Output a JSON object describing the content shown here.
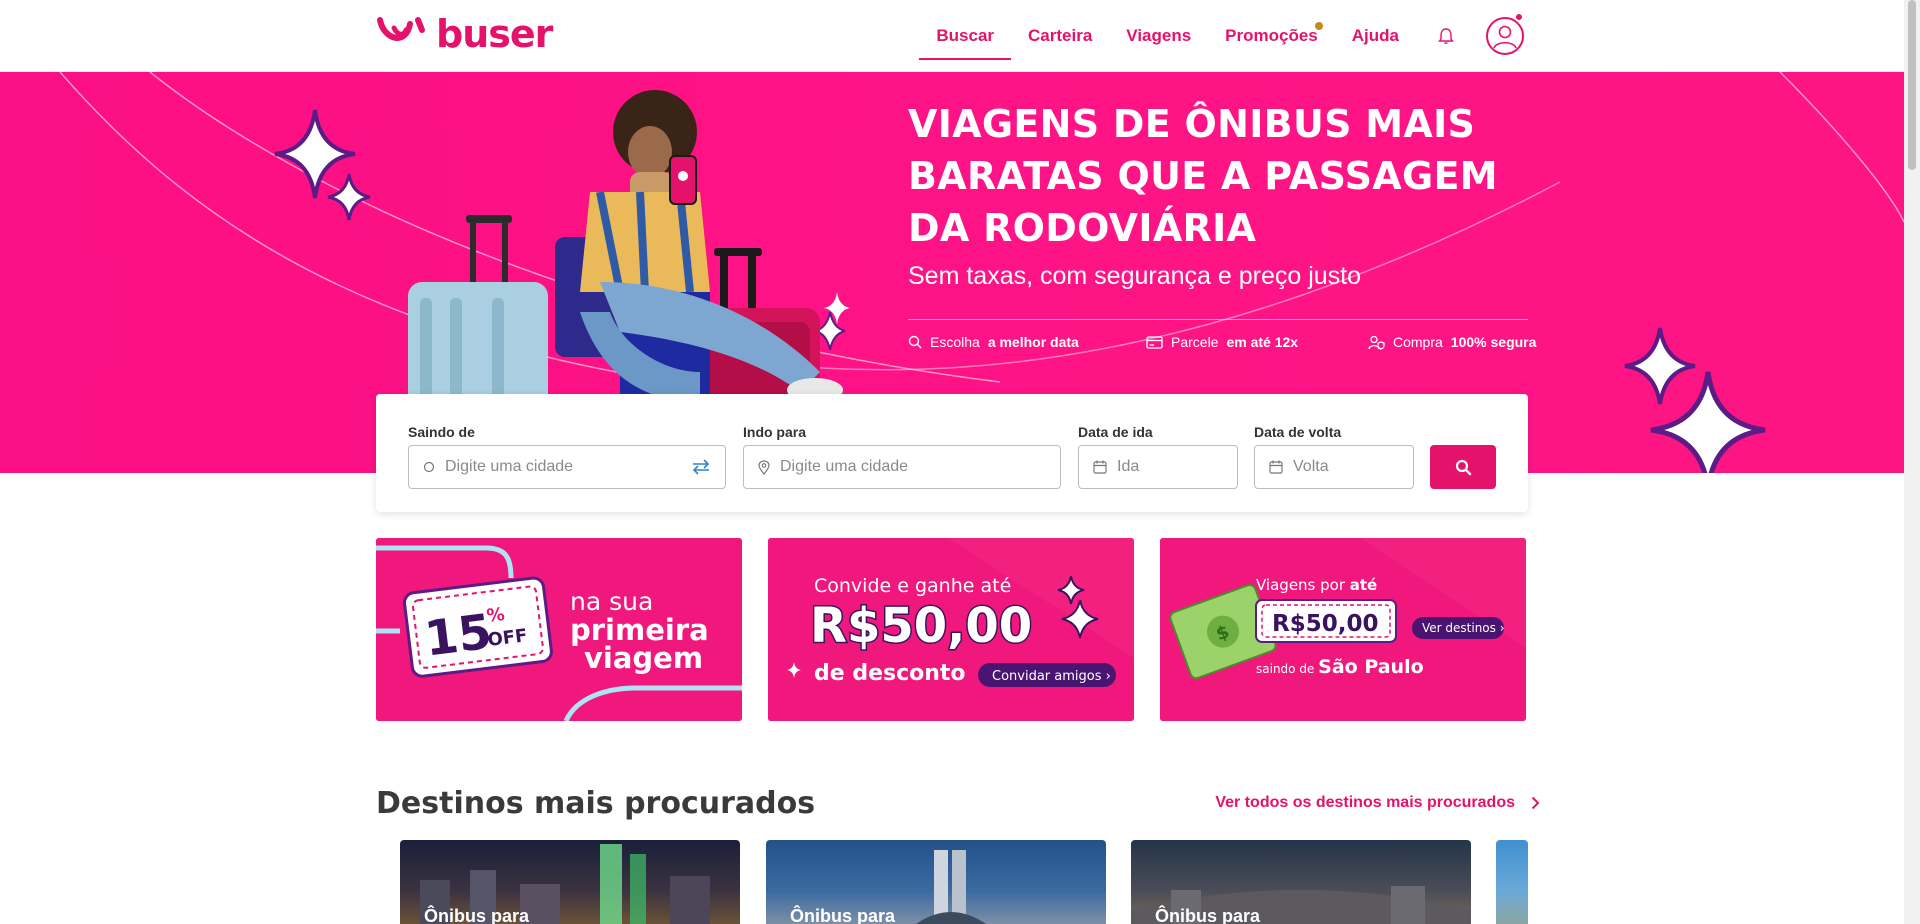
{
  "brand": {
    "name": "buser",
    "color": "#e5126b"
  },
  "nav": {
    "items": [
      {
        "label": "Buscar",
        "active": true
      },
      {
        "label": "Carteira"
      },
      {
        "label": "Viagens"
      },
      {
        "label": "Promoções"
      },
      {
        "label": "Ajuda"
      }
    ],
    "bell_icon": "bell-icon",
    "avatar_icon": "user-avatar-icon"
  },
  "hero": {
    "title": "VIAGENS DE ÔNIBUS MAIS BARATAS QUE A PASSAGEM DA RODOVIÁRIA",
    "subtitle": "Sem taxas, com segurança e preço justo",
    "features": [
      {
        "icon": "search-icon",
        "pre": "Escolha ",
        "bold": "a melhor data",
        "post": ""
      },
      {
        "icon": "card-icon",
        "pre": "Parcele ",
        "bold": "em até 12x",
        "post": ""
      },
      {
        "icon": "shield-user-icon",
        "pre": "Compra ",
        "bold": "100% segura",
        "post": ""
      }
    ]
  },
  "search": {
    "from_label": "Saindo de",
    "from_placeholder": "Digite uma cidade",
    "to_label": "Indo para",
    "to_placeholder": "Digite uma cidade",
    "depart_label": "Data de ida",
    "depart_placeholder": "Ida",
    "return_label": "Data de volta",
    "return_placeholder": "Volta"
  },
  "banners": {
    "b1": {
      "badge_number": "15",
      "badge_percent": "%",
      "badge_off": "OFF",
      "line1": "na sua",
      "line2": "primeira",
      "line3": "viagem"
    },
    "b2": {
      "line1": "Convide e ganhe até",
      "amount": "R$50,00",
      "line3": "de desconto",
      "button": "Convidar amigos ›"
    },
    "b3": {
      "line1_pre": "Viagens por ",
      "line1_bold": "até",
      "amount": "R$50,00",
      "button": "Ver destinos ›",
      "line3_pre": "saindo de ",
      "line3_bold": "São Paulo"
    }
  },
  "destinos": {
    "title": "Destinos mais procurados",
    "link": "Ver todos os destinos mais procurados",
    "cards": [
      {
        "label": "Ônibus para"
      },
      {
        "label": "Ônibus para"
      },
      {
        "label": "Ônibus para"
      }
    ]
  }
}
